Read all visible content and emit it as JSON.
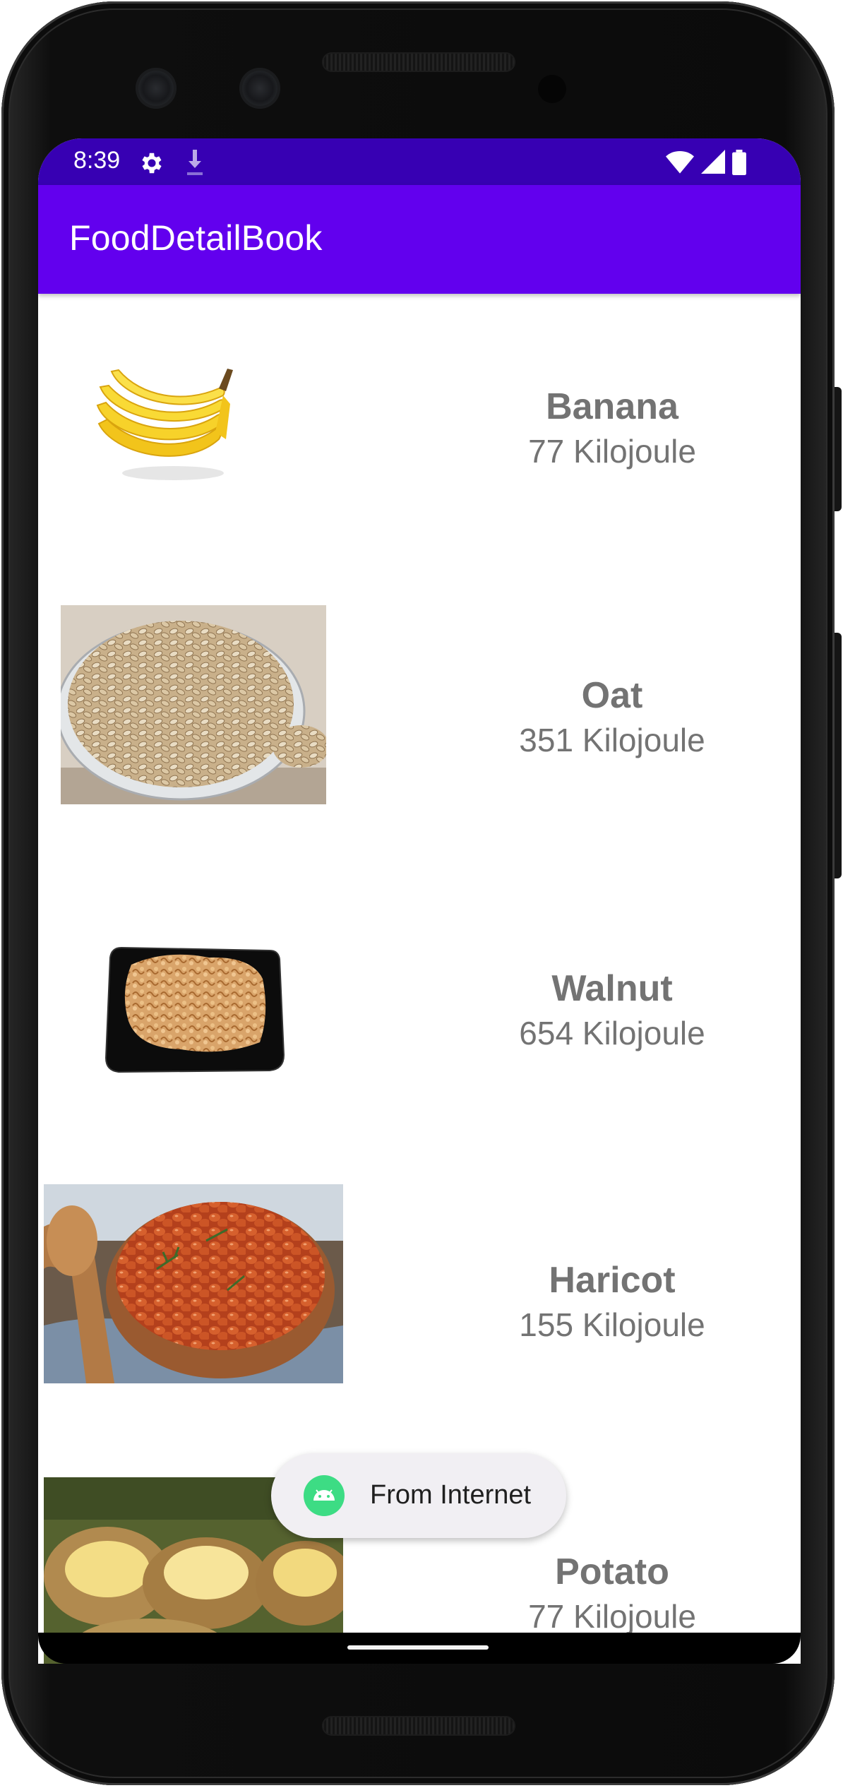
{
  "status_bar": {
    "time": "8:39",
    "icons": [
      "settings-gear-icon",
      "download-icon",
      "wifi-icon",
      "cell-signal-icon",
      "battery-icon"
    ]
  },
  "app_bar": {
    "title": "FoodDetailBook"
  },
  "foods": [
    {
      "name": "Banana",
      "energy": "77 Kilojoule",
      "image": "banana-image"
    },
    {
      "name": "Oat",
      "energy": "351 Kilojoule",
      "image": "oat-image"
    },
    {
      "name": "Walnut",
      "energy": "654 Kilojoule",
      "image": "walnut-image"
    },
    {
      "name": "Haricot",
      "energy": "155 Kilojoule",
      "image": "haricot-image"
    },
    {
      "name": "Potato",
      "energy": "77 Kilojoule",
      "image": "potato-image"
    }
  ],
  "toast": {
    "text": "From Internet",
    "icon": "android-icon"
  },
  "colors": {
    "status_bar": "#3700B3",
    "app_bar": "#6200EE",
    "item_text": "#737373",
    "toast_bg": "#f1eff3",
    "android_green": "#3ddc84"
  }
}
